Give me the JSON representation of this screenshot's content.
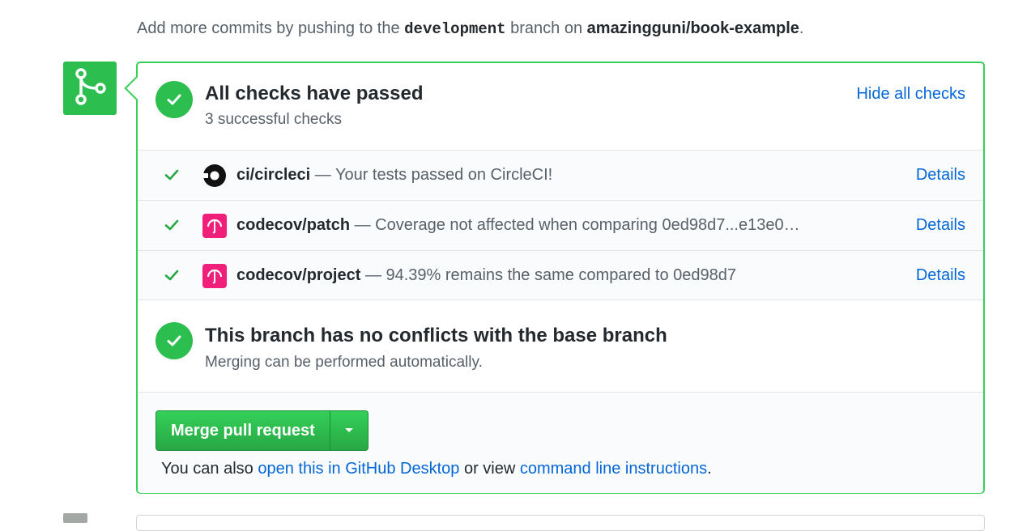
{
  "intro": {
    "prefix": "Add more commits by pushing to the ",
    "branch": "development",
    "middle": " branch on ",
    "repo": "amazingguni/book-example",
    "suffix": "."
  },
  "checks_status": {
    "title": "All checks have passed",
    "subtitle": "3 successful checks",
    "hide_link": "Hide all checks"
  },
  "checks": [
    {
      "name": "ci/circleci",
      "description": " — Your tests passed on CircleCI!",
      "details": "Details",
      "icon": "circleci-logo-icon"
    },
    {
      "name": "codecov/patch",
      "description": " — Coverage not affected when comparing 0ed98d7...e13e0…",
      "details": "Details",
      "icon": "codecov-logo-icon"
    },
    {
      "name": "codecov/project",
      "description": " — 94.39% remains the same compared to 0ed98d7",
      "details": "Details",
      "icon": "codecov-logo-icon"
    }
  ],
  "conflicts": {
    "title": "This branch has no conflicts with the base branch",
    "subtitle": "Merging can be performed automatically."
  },
  "merge": {
    "button_label": "Merge pull request",
    "also_prefix": "You can also ",
    "desktop_link": "open this in GitHub Desktop",
    "also_middle": " or view ",
    "cli_link": "command line instructions",
    "also_suffix": "."
  },
  "colors": {
    "success_green": "#2cbe4e",
    "link_blue": "#0366d6",
    "panel_border": "#34d058",
    "codecov_pink": "#f01f7a"
  }
}
